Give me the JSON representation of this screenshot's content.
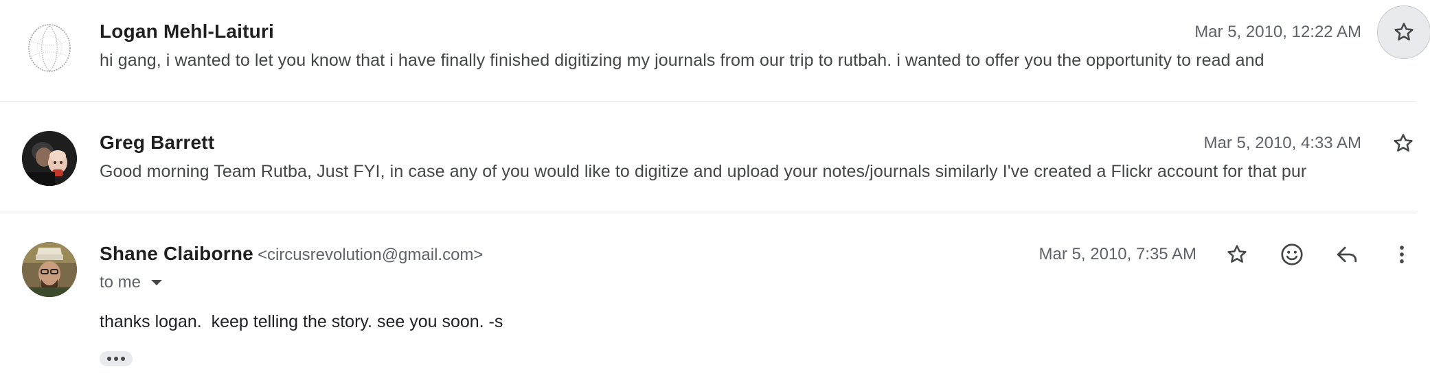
{
  "messages": [
    {
      "sender": "Logan Mehl-Laituri",
      "date": "Mar 5, 2010, 12:22 AM",
      "snippet": "hi gang, i wanted to let you know that i have finally finished digitizing my journals from our trip to rutbah. i wanted to offer you the opportunity to read and"
    },
    {
      "sender": "Greg Barrett",
      "date": "Mar 5, 2010, 4:33 AM",
      "snippet": "Good morning Team Rutba, Just FYI, in case any of you would like to digitize and upload your notes/journals similarly I've created a Flickr account for that pur"
    },
    {
      "sender": "Shane Claiborne",
      "email": "<circusrevolution@gmail.com>",
      "date": "Mar 5, 2010, 7:35 AM",
      "recipient": "to me",
      "body": "thanks logan.  keep telling the story. see you soon. -s"
    }
  ],
  "icons": {
    "star": "star-outline-icon",
    "emoji": "add-reaction-icon",
    "reply": "reply-icon",
    "more": "more-vert-icon",
    "dropdown": "chevron-down-icon",
    "trimmed": "show-trimmed-content-icon"
  },
  "colors": {
    "divider": "#e3e3e3",
    "icon": "#444746",
    "hover_bg": "#e8eaed"
  }
}
